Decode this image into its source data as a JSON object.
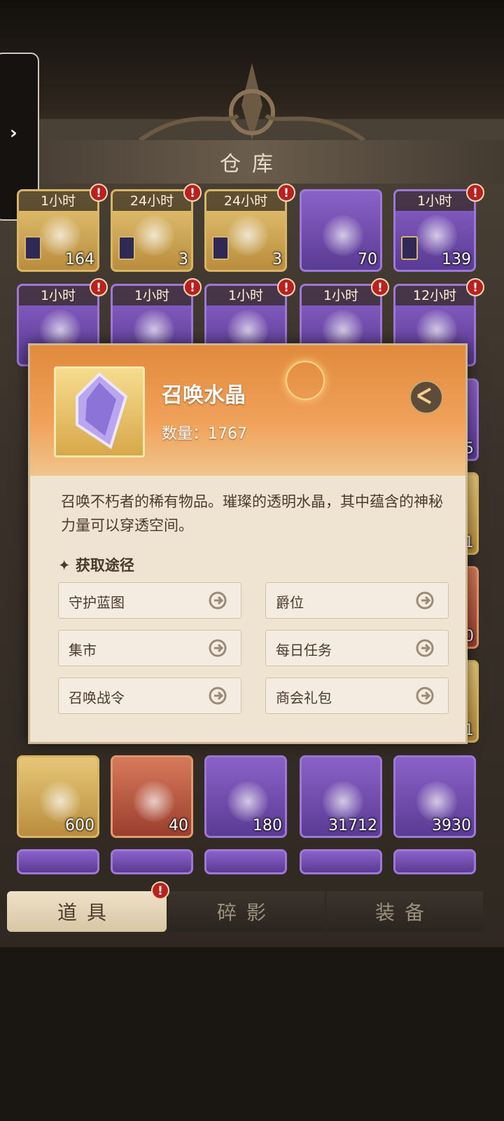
{
  "warehouse": {
    "title": "仓库"
  },
  "grid": {
    "row1": [
      {
        "timer": "1小时",
        "count": "164",
        "rarity": "gold"
      },
      {
        "timer": "24小时",
        "count": "3",
        "rarity": "gold"
      },
      {
        "timer": "24小时",
        "count": "3",
        "rarity": "gold"
      },
      {
        "timer": "",
        "count": "70",
        "rarity": "purple"
      },
      {
        "timer": "1小时",
        "count": "139",
        "rarity": "purple"
      }
    ],
    "row2": [
      {
        "timer": "1小时",
        "rarity": "purple"
      },
      {
        "timer": "1小时",
        "rarity": "purple"
      },
      {
        "timer": "1小时",
        "rarity": "purple"
      },
      {
        "timer": "1小时",
        "rarity": "purple"
      },
      {
        "timer": "12小时",
        "rarity": "purple"
      }
    ],
    "row_bottom": [
      {
        "count": "600",
        "rarity": "gold"
      },
      {
        "count": "40",
        "rarity": "red"
      },
      {
        "count": "180",
        "rarity": "purple"
      },
      {
        "count": "31712",
        "rarity": "purple"
      },
      {
        "count": "3930",
        "rarity": "purple"
      }
    ],
    "peek_counts": [
      "5",
      "5",
      "1",
      "0",
      "1"
    ]
  },
  "popup": {
    "item_name": "召唤水晶",
    "quantity": "数量：1767",
    "description": "召唤不朽者的稀有物品。璀璨的透明水晶，其中蕴含的神秘力量可以穿透空间。",
    "sources_title": "✦ 获取途径",
    "sources": [
      "守护蓝图",
      "爵位",
      "集市",
      "每日任务",
      "召唤战令",
      "商会礼包"
    ]
  },
  "tabs": [
    "道具",
    "碎影",
    "装备"
  ],
  "alert_mark": "!",
  "side_tab_glyph": "›"
}
